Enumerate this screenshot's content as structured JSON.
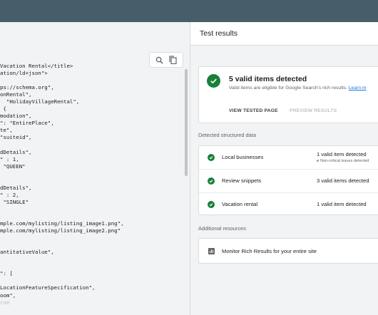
{
  "code_panel": {
    "lines": [
      {
        "t": "Vacation Rental</title>",
        "faded": false
      },
      {
        "t": "ation/ld+json\">",
        "faded": false
      },
      {
        "t": "",
        "faded": false
      },
      {
        "t": "ps://schema.org\",",
        "faded": false
      },
      {
        "t": "onRental\",",
        "faded": false
      },
      {
        "t": "  \"HolidayVillageRental\",",
        "faded": false
      },
      {
        "t": " {",
        "faded": false
      },
      {
        "t": "modation\",",
        "faded": false
      },
      {
        "t": "\": \"EntirePlace\",",
        "faded": false
      },
      {
        "t": "te\",",
        "faded": false
      },
      {
        "t": "\"suiteid\",",
        "faded": false
      },
      {
        "t": "",
        "faded": false
      },
      {
        "t": "dDetails\",",
        "faded": false
      },
      {
        "t": "\" : 1,",
        "faded": false
      },
      {
        "t": " \"QUEEN\"",
        "faded": false
      },
      {
        "t": "",
        "faded": false
      },
      {
        "t": "",
        "faded": false
      },
      {
        "t": "dDetails\",",
        "faded": false
      },
      {
        "t": "\" : 2,",
        "faded": false
      },
      {
        "t": " \"SINGLE\"",
        "faded": false
      },
      {
        "t": "",
        "faded": false
      },
      {
        "t": "",
        "faded": false
      },
      {
        "t": "mple.com/mylisting/listing_image1.png\",",
        "faded": false
      },
      {
        "t": "mple.com/mylisting/listing_image2.png\"",
        "faded": false
      },
      {
        "t": "",
        "faded": false
      },
      {
        "t": "",
        "faded": false
      },
      {
        "t": "antitativeValue\",",
        "faded": false
      },
      {
        "t": "",
        "faded": false
      },
      {
        "t": "",
        "faded": false
      },
      {
        "t": "\": [",
        "faded": false
      },
      {
        "t": "",
        "faded": false
      },
      {
        "t": "LocationFeatureSpecification\",",
        "faded": false
      },
      {
        "t": "oom\",",
        "faded": false
      },
      {
        "t": "rue",
        "faded": true
      }
    ],
    "tools": {
      "search_icon": "search-icon",
      "copy_icon": "copy-icon"
    }
  },
  "results": {
    "title": "Test results",
    "summary": {
      "title": "5 valid items detected",
      "subtitle": "Valid items are eligible for Google Search's rich results.",
      "learn_more": "Learn m",
      "view_tested_page": "VIEW TESTED PAGE",
      "preview_results": "PREVIEW RESULTS"
    },
    "detected_label": "Detected structured data",
    "items": [
      {
        "name": "Local businesses",
        "count": "1 valid item detected",
        "note": "Non-critical issues detected"
      },
      {
        "name": "Review snippets",
        "count": "3 valid items detected",
        "note": ""
      },
      {
        "name": "Vacation rental",
        "count": "1 valid item detected",
        "note": ""
      }
    ],
    "additional_label": "Additional resources",
    "resource": "Monitor Rich Results for your entire site"
  },
  "colors": {
    "topbar": "#475d6a",
    "success_green": "#188038",
    "link_blue": "#1a73e8"
  }
}
